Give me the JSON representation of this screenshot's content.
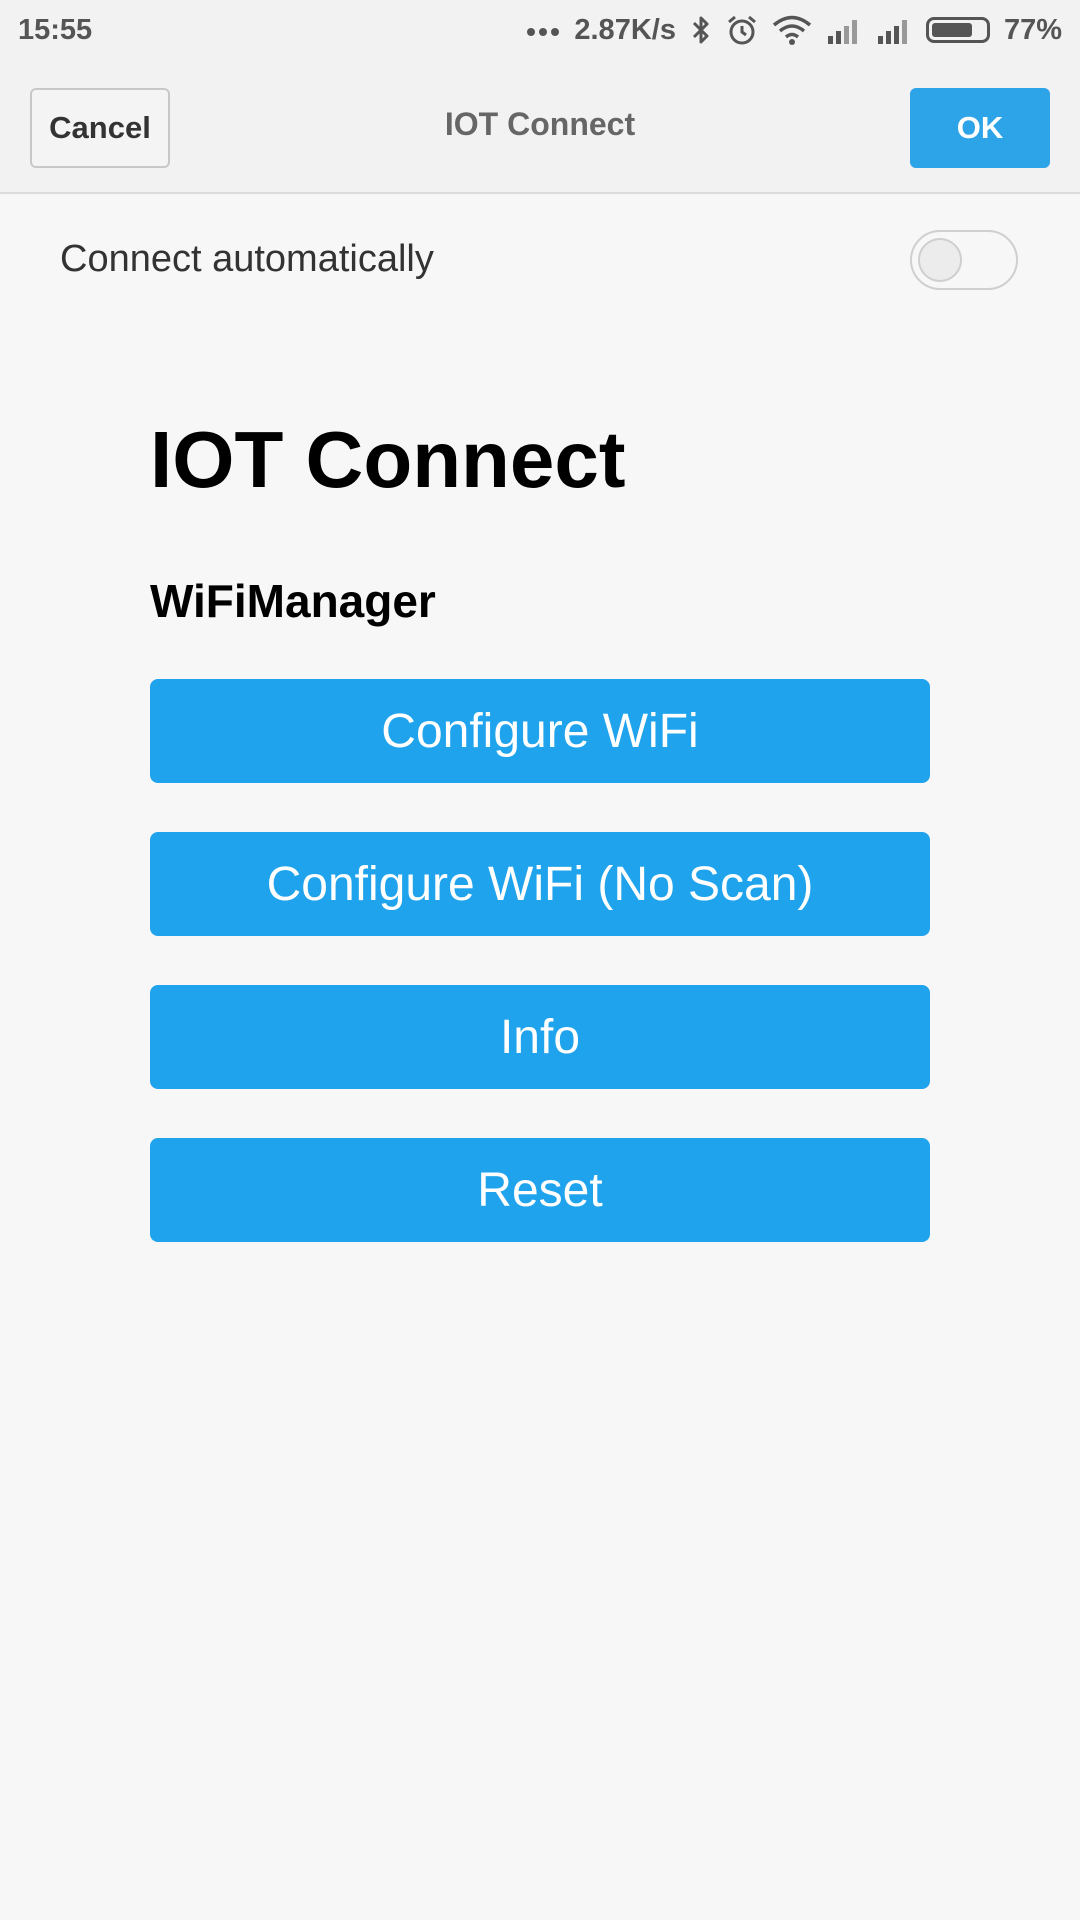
{
  "status_bar": {
    "time": "15:55",
    "net_speed": "2.87K/s",
    "battery": "77%",
    "battery_level": 0.77,
    "icons": [
      "more-dots-icon",
      "bluetooth-icon",
      "alarm-icon",
      "wifi-icon",
      "signal-icon",
      "signal-icon",
      "battery-icon"
    ]
  },
  "app_bar": {
    "cancel_label": "Cancel",
    "title": "IOT Connect",
    "ok_label": "OK"
  },
  "auto_connect": {
    "label": "Connect automatically",
    "enabled": false
  },
  "page": {
    "heading": "IOT Connect",
    "subheading": "WiFiManager",
    "buttons": [
      {
        "label": "Configure WiFi"
      },
      {
        "label": "Configure WiFi (No Scan)"
      },
      {
        "label": "Info"
      },
      {
        "label": "Reset"
      }
    ]
  },
  "colors": {
    "accent": "#1fa3ec",
    "ok_button": "#2ea4e8",
    "background": "#f7f7f7"
  }
}
